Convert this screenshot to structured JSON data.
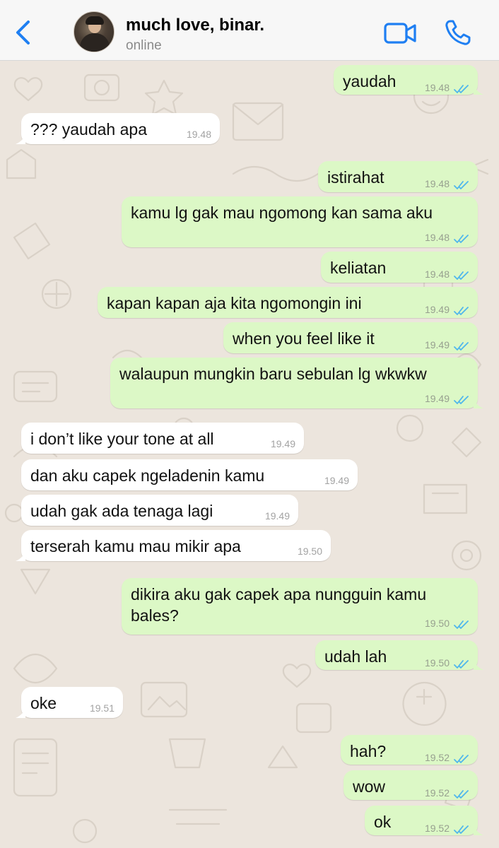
{
  "header": {
    "back_icon": "chevron-left-icon",
    "contact_name": "much love, binar.",
    "status": "online",
    "video_icon": "video-camera-icon",
    "call_icon": "phone-icon",
    "accent_color": "#1f7ff2"
  },
  "colors": {
    "outgoing_bubble": "#dcf8c6",
    "incoming_bubble": "#ffffff",
    "read_tick": "#4fb6ec",
    "chat_background": "#ece5dd"
  },
  "messages": [
    {
      "direction": "out",
      "text": "yaudah",
      "time": "19.48",
      "read": true
    },
    {
      "direction": "in",
      "text": "??? yaudah apa",
      "time": "19.48"
    },
    {
      "direction": "out",
      "text": "istirahat",
      "time": "19.48",
      "read": true
    },
    {
      "direction": "out",
      "text": "kamu lg gak mau ngomong kan sama aku",
      "time": "19.48",
      "read": true
    },
    {
      "direction": "out",
      "text": "keliatan",
      "time": "19.48",
      "read": true
    },
    {
      "direction": "out",
      "text": "kapan kapan aja kita ngomongin ini",
      "time": "19.49",
      "read": true
    },
    {
      "direction": "out",
      "text": "when you feel like it",
      "time": "19.49",
      "read": true
    },
    {
      "direction": "out",
      "text": "walaupun mungkin baru sebulan lg wkwkw",
      "time": "19.49",
      "read": true
    },
    {
      "direction": "in",
      "text": "i don’t like your tone at all",
      "time": "19.49"
    },
    {
      "direction": "in",
      "text": "dan aku capek ngeladenin kamu",
      "time": "19.49"
    },
    {
      "direction": "in",
      "text": "udah gak ada tenaga lagi",
      "time": "19.49"
    },
    {
      "direction": "in",
      "text": "terserah kamu mau mikir apa",
      "time": "19.50"
    },
    {
      "direction": "out",
      "text": "dikira aku gak capek apa nungguin kamu bales?",
      "time": "19.50",
      "read": true
    },
    {
      "direction": "out",
      "text": "udah lah",
      "time": "19.50",
      "read": true
    },
    {
      "direction": "in",
      "text": "oke",
      "time": "19.51"
    },
    {
      "direction": "out",
      "text": "hah?",
      "time": "19.52",
      "read": true
    },
    {
      "direction": "out",
      "text": "wow",
      "time": "19.52",
      "read": true
    },
    {
      "direction": "out",
      "text": "ok",
      "time": "19.52",
      "read": true
    }
  ]
}
